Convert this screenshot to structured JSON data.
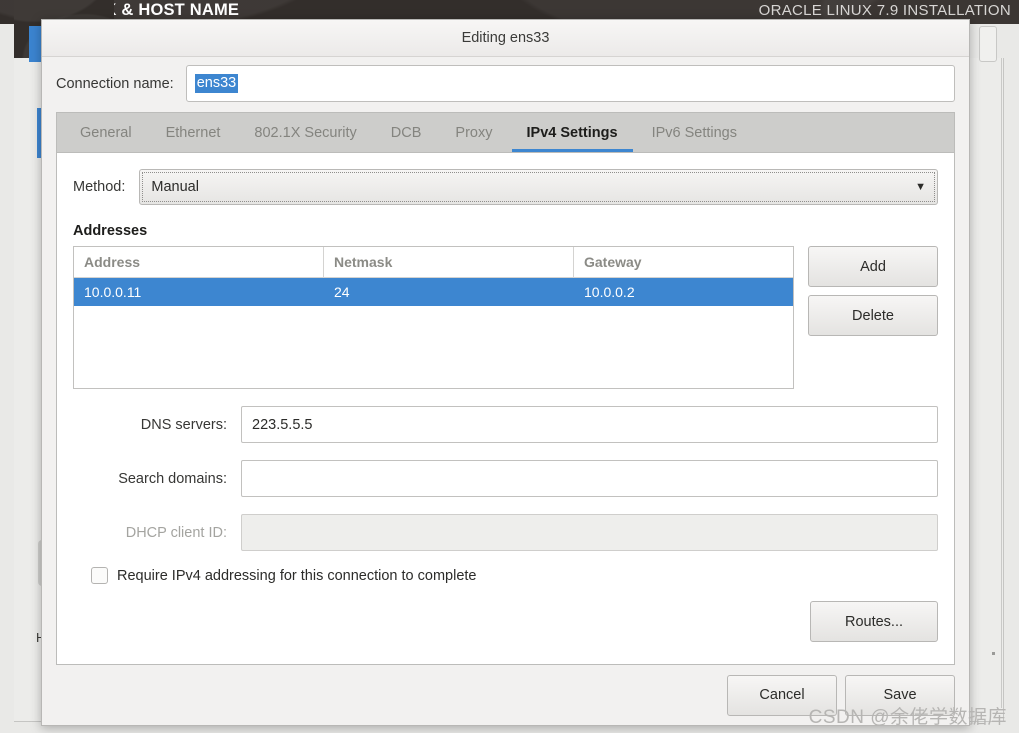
{
  "installer": {
    "title": "NETWORK & HOST NAME",
    "step": "ORACLE LINUX 7.9 INSTALLATION",
    "bg_letter": "H"
  },
  "dialog": {
    "title": "Editing ens33",
    "connection": {
      "label": "Connection name:",
      "value": "ens33",
      "selected": true
    },
    "tabs": [
      {
        "label": "General",
        "active": false
      },
      {
        "label": "Ethernet",
        "active": false
      },
      {
        "label": "802.1X Security",
        "active": false
      },
      {
        "label": "DCB",
        "active": false
      },
      {
        "label": "Proxy",
        "active": false
      },
      {
        "label": "IPv4 Settings",
        "active": true
      },
      {
        "label": "IPv6 Settings",
        "active": false
      }
    ],
    "ipv4": {
      "method_label": "Method:",
      "method_value": "Manual",
      "method_caret": "chevron-down-icon",
      "addresses_title": "Addresses",
      "table": {
        "headers": [
          "Address",
          "Netmask",
          "Gateway"
        ],
        "rows": [
          {
            "address": "10.0.0.11",
            "netmask": "24",
            "gateway": "10.0.0.2",
            "selected": true
          }
        ]
      },
      "add_label": "Add",
      "delete_label": "Delete",
      "dns_label": "DNS servers:",
      "dns_value": "223.5.5.5",
      "dns_placeholder": "",
      "search_label": "Search domains:",
      "search_value": "",
      "search_placeholder": "",
      "dhcp_label": "DHCP client ID:",
      "dhcp_value": "",
      "dhcp_placeholder": "",
      "dhcp_disabled": true,
      "require_label": "Require IPv4 addressing for this connection to complete",
      "require_checked": false,
      "routes_label": "Routes..."
    },
    "footer": {
      "cancel_label": "Cancel",
      "save_label": "Save"
    }
  },
  "watermark": "CSDN @余佬学数据库",
  "colors": {
    "accent_blue": "#3d86d0",
    "header_dark": "#332e2b",
    "dialog_bg": "#f2f1f0",
    "tabstrip_bg": "#cdcdcb"
  }
}
